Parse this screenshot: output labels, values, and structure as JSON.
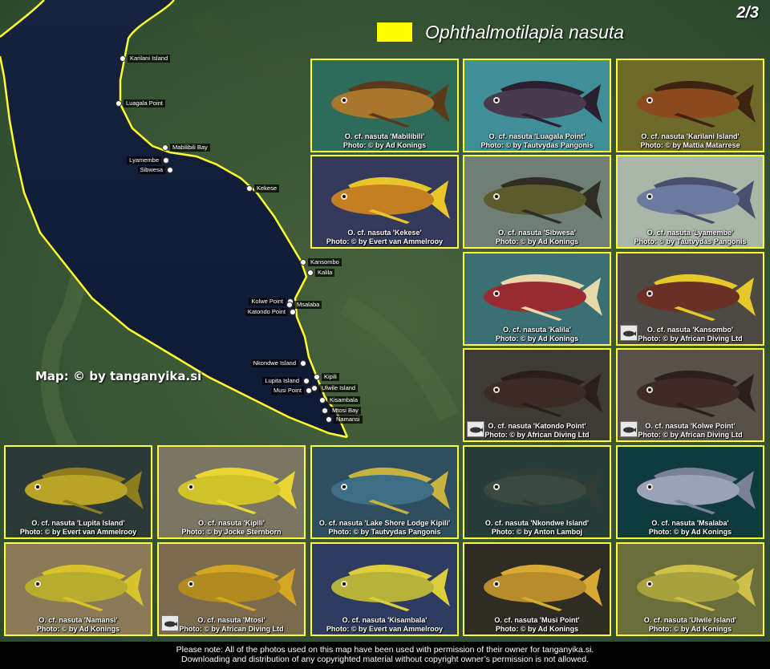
{
  "page_number": "2/3",
  "legend": {
    "title": "Ophthalmotilapia nasuta",
    "swatch_color": "#ffff00"
  },
  "map_credit": "Map: © by tanganyika.si",
  "footer": {
    "line1": "Please note: All of the photos used on this map have been used with permission of their owner for tanganyika.si.",
    "line2": "Downloading and distribution of any copyrighted material without copyright owner’s permission is not allowed."
  },
  "locations": [
    {
      "name": "Karilani Island",
      "side": "right"
    },
    {
      "name": "Luagala Point",
      "side": "right"
    },
    {
      "name": "Mabilibili Bay",
      "side": "right"
    },
    {
      "name": "Lyamembe",
      "side": "left"
    },
    {
      "name": "Sibwesa",
      "side": "left"
    },
    {
      "name": "Kekese",
      "side": "right"
    },
    {
      "name": "Kansombo",
      "side": "right"
    },
    {
      "name": "Kalila",
      "side": "right"
    },
    {
      "name": "Kolwe Point",
      "side": "left"
    },
    {
      "name": "Msalaba",
      "side": "right"
    },
    {
      "name": "Katondo Point",
      "side": "left"
    },
    {
      "name": "Nkondwe Island",
      "side": "left"
    },
    {
      "name": "Kipili",
      "side": "right"
    },
    {
      "name": "Lupita Island",
      "side": "left"
    },
    {
      "name": "Ulwile Island",
      "side": "right"
    },
    {
      "name": "Musi Point",
      "side": "left"
    },
    {
      "name": "Kisambala",
      "side": "right"
    },
    {
      "name": "Mtosi Bay",
      "side": "right"
    },
    {
      "name": "Namansi",
      "side": "right"
    }
  ],
  "photos": [
    {
      "caption": "O. cf. nasuta 'Mabilibili'",
      "credit": "Photo: © by Ad Konings",
      "bg": "#2f6b5a",
      "fish": "#a9772c",
      "fin": "#5b3a1a",
      "logo": false
    },
    {
      "caption": "O. cf. nasuta 'Luagala Point'",
      "credit": "Photo: © by Tautvydas Pangonis",
      "bg": "#3f8e98",
      "fish": "#4a3a4e",
      "fin": "#2a2030",
      "logo": false
    },
    {
      "caption": "O. cf. nasuta 'Karilani Island'",
      "credit": "Photo: © by Mattia Matarrese",
      "bg": "#6d6a2a",
      "fish": "#8a4a1e",
      "fin": "#3d2310",
      "logo": false
    },
    {
      "caption": "O. cf. nasuta 'Kekese'",
      "credit": "Photo: © by Evert van Ammelrooy",
      "bg": "#343a5c",
      "fish": "#c47f22",
      "fin": "#e8c62a",
      "logo": false
    },
    {
      "caption": "O. cf. nasuta 'Sibwesa'",
      "credit": "Photo: © by Ad Konings",
      "bg": "#6f7f76",
      "fish": "#5a5c2e",
      "fin": "#2e2e24",
      "logo": false
    },
    {
      "caption": "O. cf. nasuta 'Lyamembe'",
      "credit": "Photo: © by Tautvydas Pangonis",
      "bg": "#a9b7a6",
      "fish": "#6c7aa0",
      "fin": "#4a4f6e",
      "logo": false
    },
    {
      "caption": "O. cf. nasuta 'Kalila'",
      "credit": "Photo: © by Ad Konings",
      "bg": "#3a6f73",
      "fish": "#9a2b33",
      "fin": "#e6d8a8",
      "logo": false
    },
    {
      "caption": "O. cf. nasuta 'Kansombo'",
      "credit": "Photo: © by African Diving Ltd",
      "bg": "#4c4a42",
      "fish": "#6a3026",
      "fin": "#e6c82a",
      "logo": true
    },
    {
      "caption": "O. cf. nasuta 'Katondo Point'",
      "credit": "Photo: © by African Diving Ltd",
      "bg": "#3e3a34",
      "fish": "#3c2a24",
      "fin": "#2a1e1a",
      "logo": true
    },
    {
      "caption": "O. cf. nasuta 'Kolwe Point'",
      "credit": "Photo: © by African Diving Ltd",
      "bg": "#57514a",
      "fish": "#3e2a26",
      "fin": "#2c1f1c",
      "logo": true
    },
    {
      "caption": "O. cf. nasuta 'Lupita Island'",
      "credit": "Photo: © by Evert van Ammelrooy",
      "bg": "#2b3a36",
      "fish": "#b9a428",
      "fin": "#8e7d1e",
      "logo": false
    },
    {
      "caption": "O. cf. nasuta 'Kipili'",
      "credit": "Photo: © by Jocke Sternborn",
      "bg": "#7a7664",
      "fish": "#d2c22a",
      "fin": "#e9d534",
      "logo": false
    },
    {
      "caption": "O. cf. nasuta 'Lake Shore Lodge Kipili'",
      "credit": "Photo: © by Tautvydas Pangonis",
      "bg": "#2f4f60",
      "fish": "#3c6e86",
      "fin": "#c8b340",
      "logo": false
    },
    {
      "caption": "O. cf. nasuta 'Nkondwe Island'",
      "credit": "Photo: © by Anton Lamboj",
      "bg": "#263d3a",
      "fish": "#3a4a40",
      "fin": "#303c34",
      "logo": false
    },
    {
      "caption": "O. cf. nasuta 'Msalaba'",
      "credit": "Photo: © by Ad Konings",
      "bg": "#0f3a3e",
      "fish": "#9aa2b8",
      "fin": "#7a8298",
      "logo": false
    },
    {
      "caption": "O. cf. nasuta 'Namansi'",
      "credit": "Photo: © by Ad Konings",
      "bg": "#8a7a58",
      "fish": "#b6ad2e",
      "fin": "#d8c42a",
      "logo": false
    },
    {
      "caption": "O. cf. nasuta 'Mtosi'",
      "credit": "Photo: © by African Diving Ltd",
      "bg": "#7a6a4e",
      "fish": "#b08a1e",
      "fin": "#d4a624",
      "logo": true
    },
    {
      "caption": "O. cf. nasuta 'Kisambala'",
      "credit": "Photo: © by Evert van Ammelrooy",
      "bg": "#2f3c62",
      "fish": "#b6b23a",
      "fin": "#dccd3a",
      "logo": false
    },
    {
      "caption": "O. cf. nasuta 'Musi Point'",
      "credit": "Photo: © by Ad Konings",
      "bg": "#2f2c24",
      "fish": "#b88c2a",
      "fin": "#d8aa34",
      "logo": false
    },
    {
      "caption": "O. cf. nasuta 'Ulwile Island'",
      "credit": "Photo: © by Ad Konings",
      "bg": "#6a6e3a",
      "fish": "#a8a23e",
      "fin": "#cfc04a",
      "logo": false
    }
  ]
}
